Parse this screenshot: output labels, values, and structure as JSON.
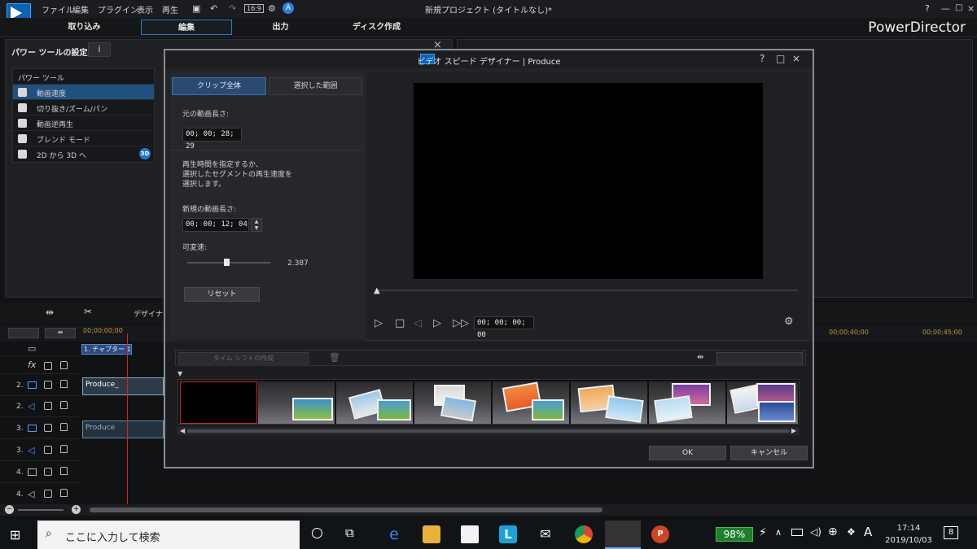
{
  "menu": {
    "items": [
      "ファイル",
      "編集",
      "プラグイン",
      "表示",
      "再生"
    ],
    "window_title": "新規プロジェクト (タイトルなし)*",
    "counter": "A",
    "brand": "PowerDirector"
  },
  "main_tabs": [
    "取り込み",
    "編集",
    "出力",
    "ディスク作成"
  ],
  "power_tools": {
    "title": "パワー ツールの設定",
    "info": "i",
    "header": "パワー ツール",
    "items": [
      "動画速度",
      "切り抜き/ズーム/パン",
      "動画逆再生",
      "ブレンド モード",
      "2D から 3D へ"
    ],
    "badge_3d": "3D",
    "close": "×"
  },
  "timeline": {
    "toolbar_designer": "デザイナー",
    "ruler_start": "00;00;00;00",
    "ruler_right": [
      "00;00;40;00",
      "00;00;45;00"
    ],
    "chapter": "1. チャプター 1",
    "fx": "fx",
    "tracks": [
      "2.",
      "2.",
      "3.",
      "3.",
      "4.",
      "4."
    ],
    "clip1": "Produce_",
    "clip2": "Produce"
  },
  "dialog": {
    "title": "ビデオ スピード デザイナー | Produce",
    "help": "?",
    "maximize": "□",
    "close": "×",
    "tab_all": "クリップ全体",
    "tab_range": "選択した範囲",
    "orig_label": "元の動画長さ:",
    "orig_value": "00; 00; 28; 29",
    "instructions": "再生時間を指定するか、\n選択したセグメントの再生速度を\n選択します。",
    "new_label": "新規の動画長さ:",
    "new_value": "00; 00; 12; 04",
    "speed_label": "可変速:",
    "speed_value": "2.387",
    "speed_slider_fraction": 0.47,
    "reset": "リセット",
    "timecode": "00; 00; 00; 00",
    "timeshift": "タイム シフトの作成",
    "ok": "OK",
    "cancel": "キャンセル"
  },
  "taskbar": {
    "search_placeholder": "ここに入力して検索",
    "battery": "98%",
    "time": "17:14",
    "date": "2019/10/03",
    "notifications": "8",
    "ime": "A"
  },
  "colors": {
    "accent": "#1f7fd6",
    "selection": "#2b4a72",
    "battery": "#1d7f2c"
  }
}
